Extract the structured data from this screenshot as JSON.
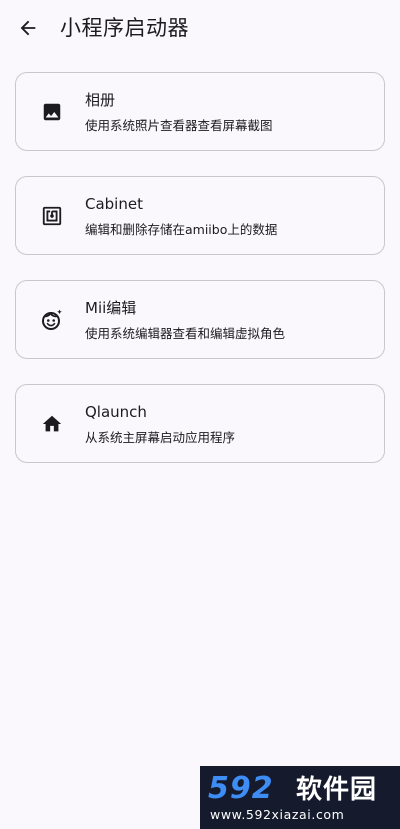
{
  "app_bar": {
    "title": "小程序启动器",
    "back_icon": "arrow-back-icon"
  },
  "items": [
    {
      "icon": "image-icon",
      "title": "相册",
      "subtitle": "使用系统照片查看器查看屏幕截图"
    },
    {
      "icon": "nfc-tag-icon",
      "title": "Cabinet",
      "subtitle": "编辑和删除存储在amiibo上的数据"
    },
    {
      "icon": "mii-face-icon",
      "title": "Mii编辑",
      "subtitle": "使用系统编辑器查看和编辑虚拟角色"
    },
    {
      "icon": "home-icon",
      "title": "Qlaunch",
      "subtitle": "从系统主屏幕启动应用程序"
    }
  ],
  "watermark": {
    "logo": "592",
    "brand": "软件园",
    "url": "www.592xiazai.com"
  }
}
